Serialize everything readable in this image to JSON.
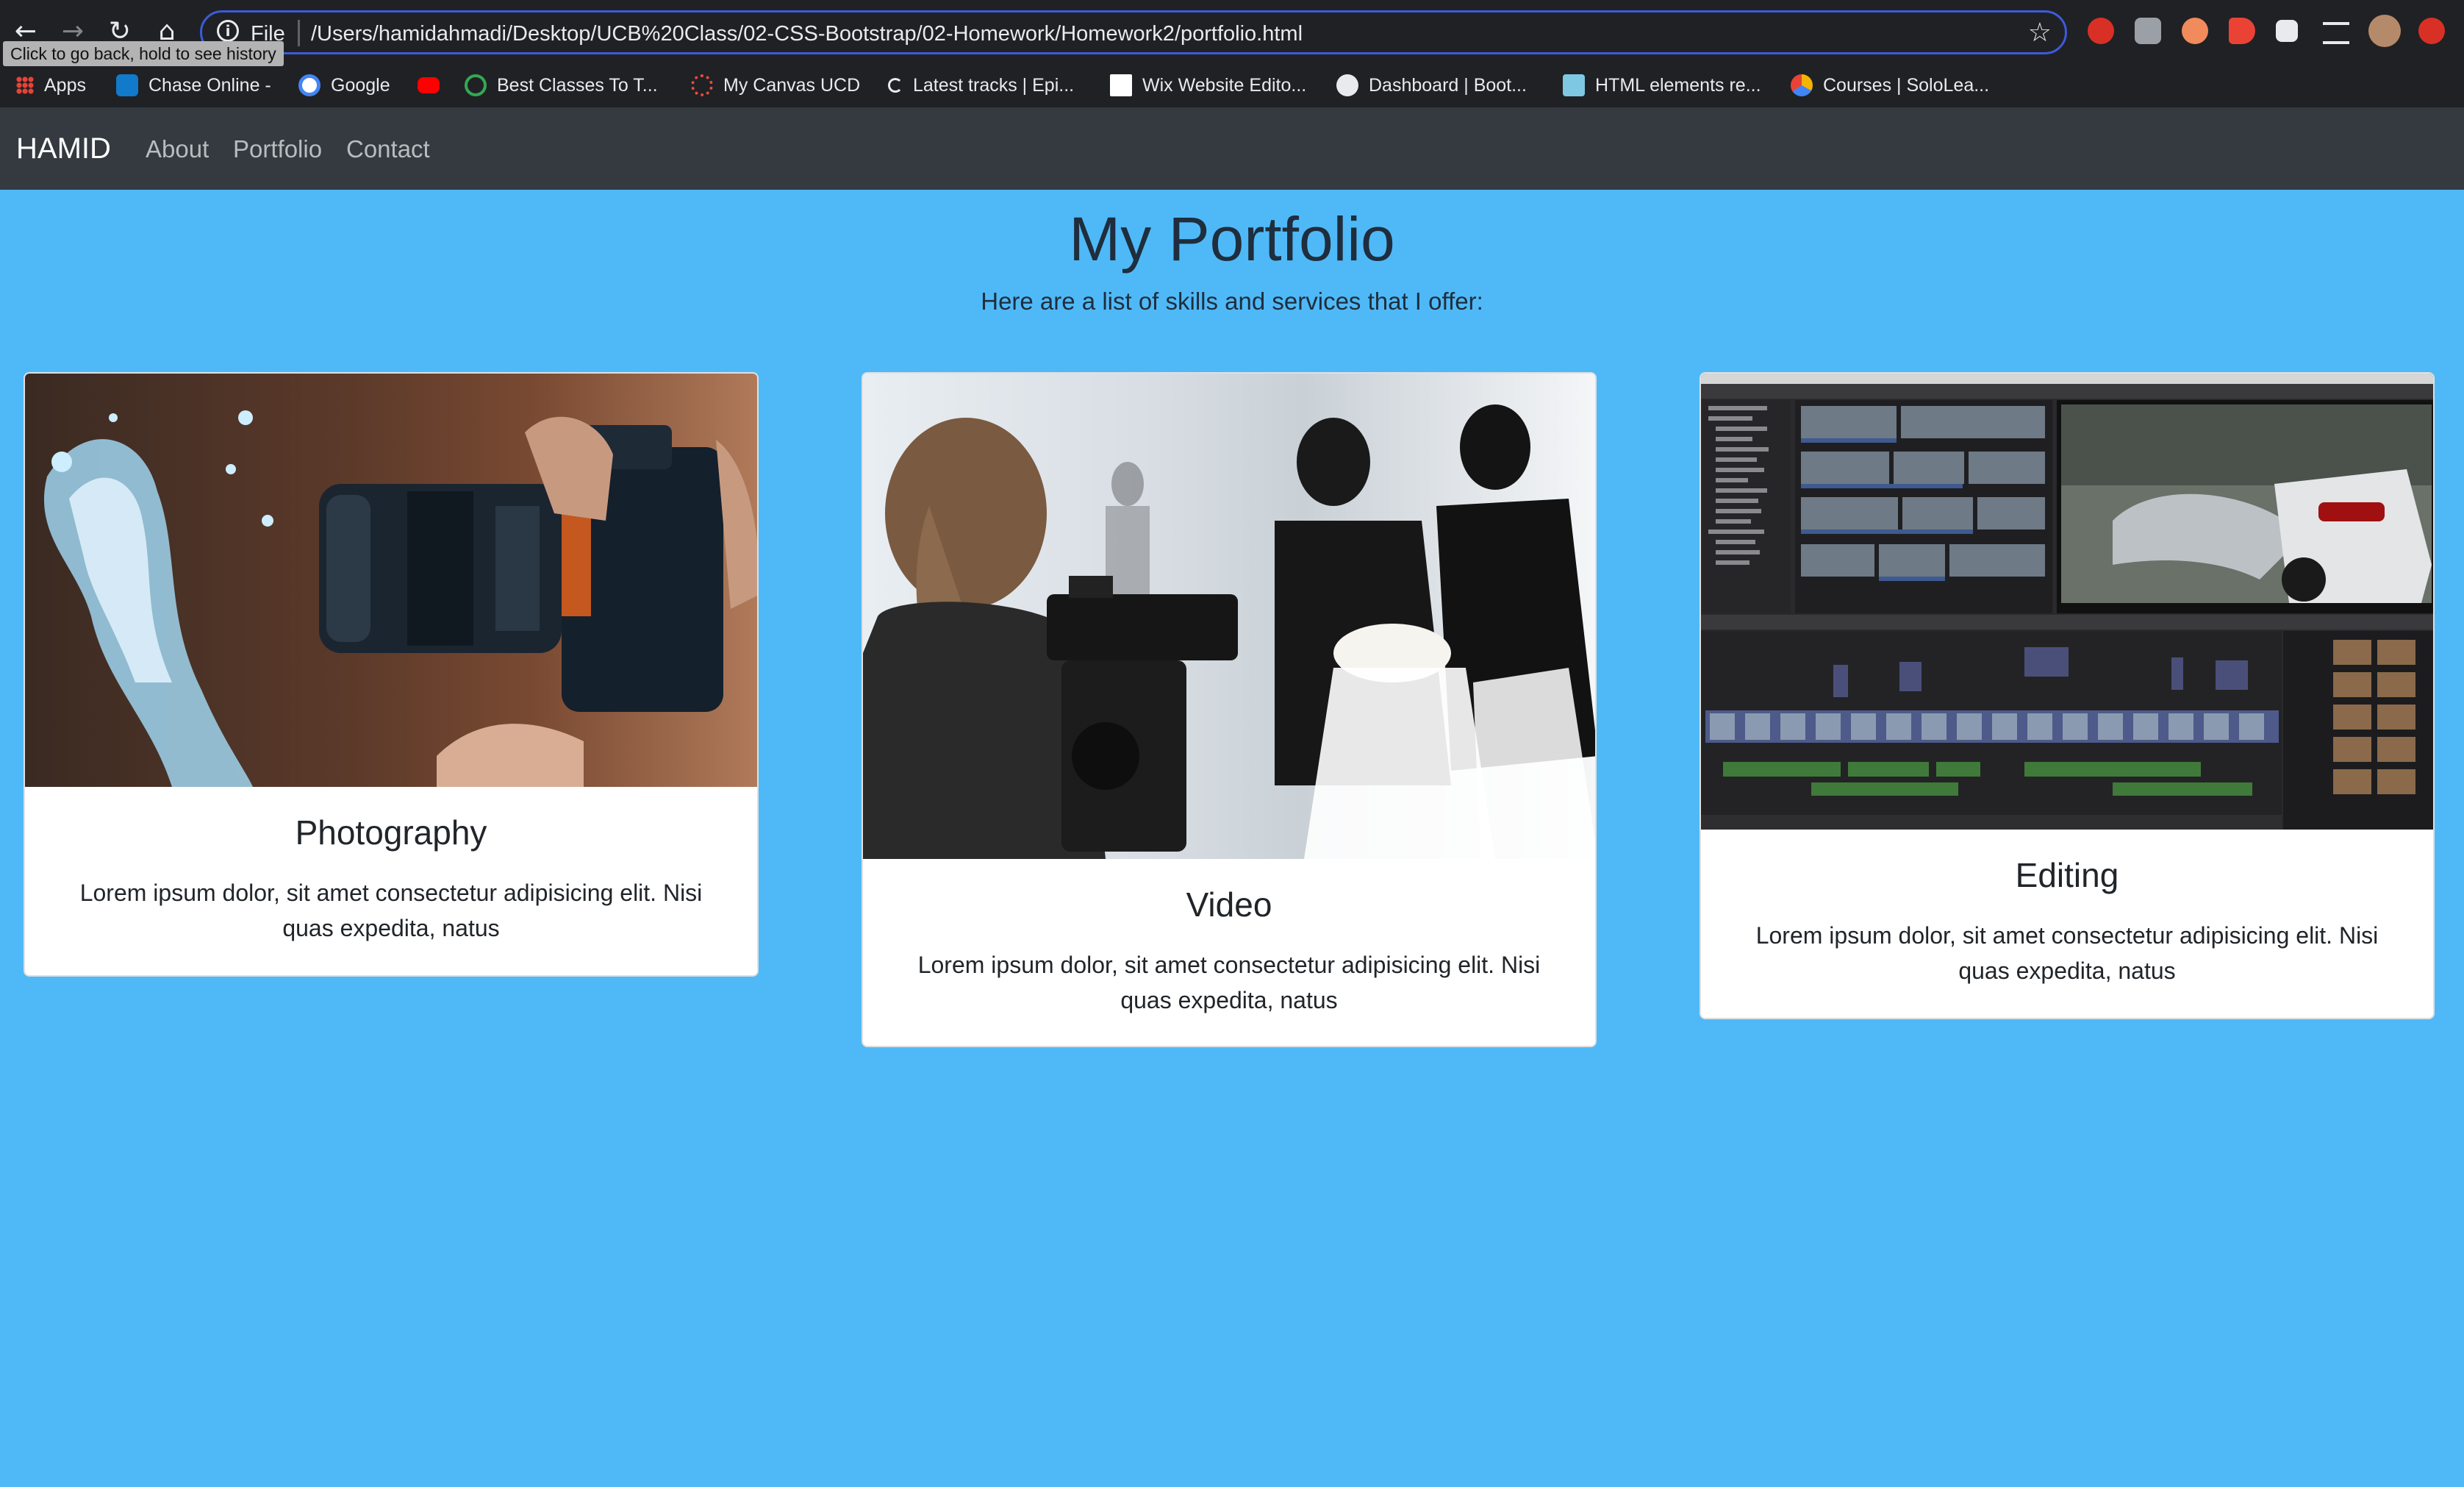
{
  "browser": {
    "nav": {
      "back": "←",
      "forward": "→",
      "reload": "↻",
      "home": "⌂"
    },
    "address": {
      "scheme": "File",
      "url": "/Users/hamidahmadi/Desktop/UCB%20Class/02-CSS-Bootstrap/02-Homework/Homework2/portfolio.html",
      "info_icon": "i",
      "star": "☆"
    },
    "tooltip": "Click to go back, hold to see history",
    "bookmarks": [
      "Apps",
      "Chase Online -",
      "Google",
      "",
      "Best Classes To T...",
      "My Canvas UCD",
      "Latest tracks | Epi...",
      "Wix Website Edito...",
      "Dashboard | Boot...",
      "HTML elements re...",
      "Courses | SoloLea..."
    ],
    "extension_icons": [
      "red-shield-icon",
      "text-extension-icon",
      "orange-face-icon",
      "red-arrow-icon",
      "puzzle-icon",
      "playlist-icon",
      "profile-avatar-icon",
      "update-icon"
    ]
  },
  "navbar": {
    "brand": "HAMID",
    "links": [
      "About",
      "Portfolio",
      "Contact"
    ]
  },
  "page": {
    "title": "My Portfolio",
    "subtitle": "Here are a list of skills and services that I offer:"
  },
  "cards": [
    {
      "title": "Photography",
      "text": "Lorem ipsum dolor, sit amet consectetur adipisicing elit. Nisi quas expedita, natus",
      "image": "camera-water-splash-photo"
    },
    {
      "title": "Video",
      "text": "Lorem ipsum dolor, sit amet consectetur adipisicing elit. Nisi quas expedita, natus",
      "image": "wedding-videographer-photo"
    },
    {
      "title": "Editing",
      "text": "Lorem ipsum dolor, sit amet consectetur adipisicing elit. Nisi quas expedita, natus",
      "image": "video-editor-screenshot"
    }
  ],
  "colors": {
    "page_bg": "#4fb9f7",
    "navbar_bg": "#343a40",
    "chrome_bg": "#202124",
    "text": "#212529"
  }
}
